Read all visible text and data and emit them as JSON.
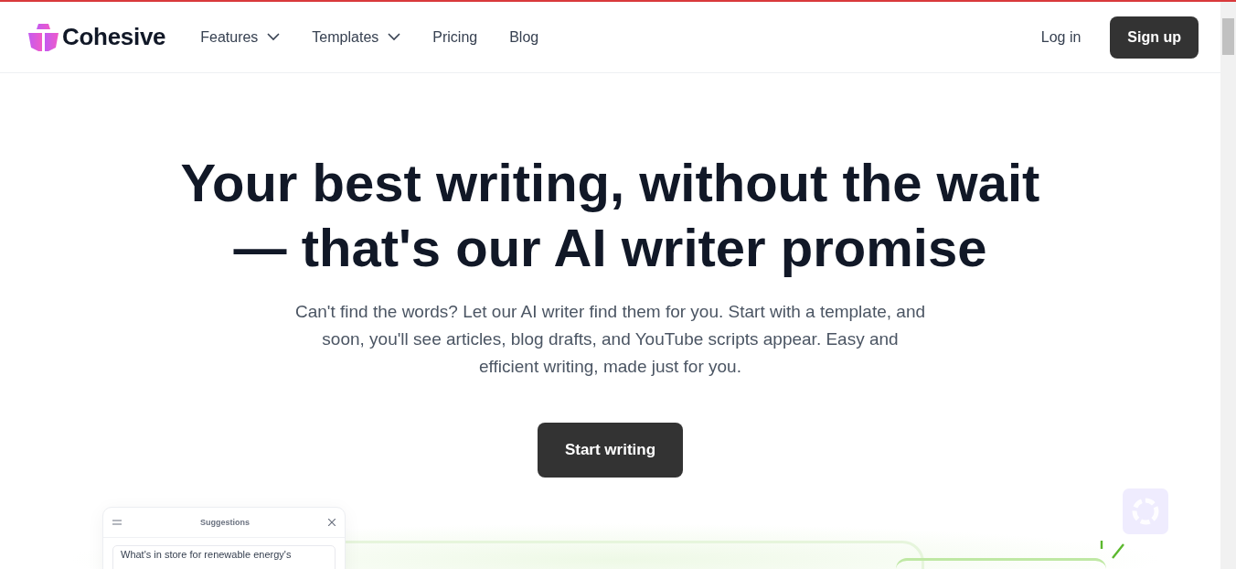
{
  "brand": {
    "name": "Cohesive"
  },
  "nav": [
    {
      "label": "Features",
      "kind": "dropdown"
    },
    {
      "label": "Templates",
      "kind": "dropdown"
    },
    {
      "label": "Pricing",
      "kind": "link"
    },
    {
      "label": "Blog",
      "kind": "link"
    }
  ],
  "actions": [
    {
      "label": "Log in",
      "kind": "link"
    },
    {
      "label": "Sign up",
      "kind": "primary"
    }
  ],
  "hero": {
    "headline": "Your best writing, without the wait — that's our AI writer promise",
    "lede": "Can't find the words? Let our AI writer find them for you. Start with a template, and soon, you'll see articles, blog drafts, and YouTube scripts appear. Easy and efficient writing, made just for you.",
    "cta": "Start writing"
  },
  "preview": {
    "panel_title": "Suggestions",
    "suggestion": "What's in store for renewable energy's"
  }
}
